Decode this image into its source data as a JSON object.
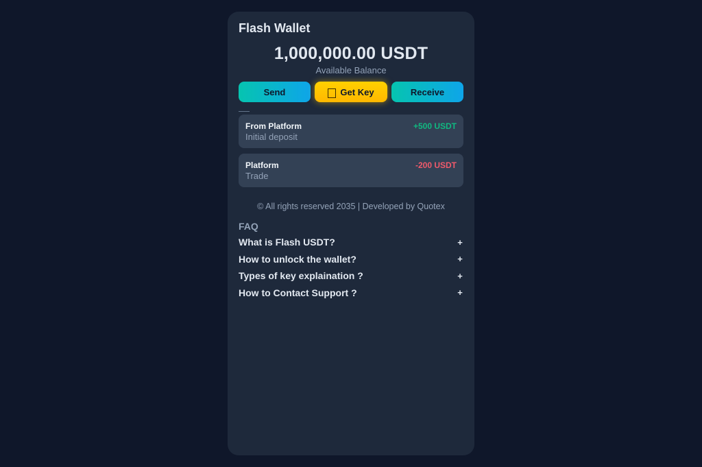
{
  "app": {
    "title": "Flash Wallet"
  },
  "balance": {
    "amount": "1,000,000.00 USDT",
    "label": "Available Balance"
  },
  "actions": {
    "send_label": "Send",
    "get_key_label": "Get Key",
    "receive_label": "Receive",
    "get_key_icon": "key-icon"
  },
  "transactions": [
    {
      "name": "From Platform",
      "description": "Initial deposit",
      "amount": "+500 USDT",
      "color": "#10b981"
    },
    {
      "name": "Platform",
      "description": "Trade",
      "amount": "-200 USDT",
      "color": "#f05a6b"
    }
  ],
  "footer": {
    "text": "© All rights reserved 2035 | Developed by Quotex"
  },
  "faq": {
    "title": "FAQ",
    "toggle_symbol": "+",
    "items": [
      {
        "question": "What is Flash USDT?"
      },
      {
        "question": "How to unlock the wallet?"
      },
      {
        "question": "Types of key explaination ?"
      },
      {
        "question": "How to Contact Support ?"
      }
    ]
  },
  "colors": {
    "page_bg": "#0f172a",
    "card_bg": "#1e293b",
    "tx_bg": "#334155",
    "accent_gradient_start": "#06c4b0",
    "accent_gradient_end": "#0ea5e9",
    "key_button": "#ffc400",
    "positive": "#10b981",
    "negative": "#f05a6b"
  }
}
